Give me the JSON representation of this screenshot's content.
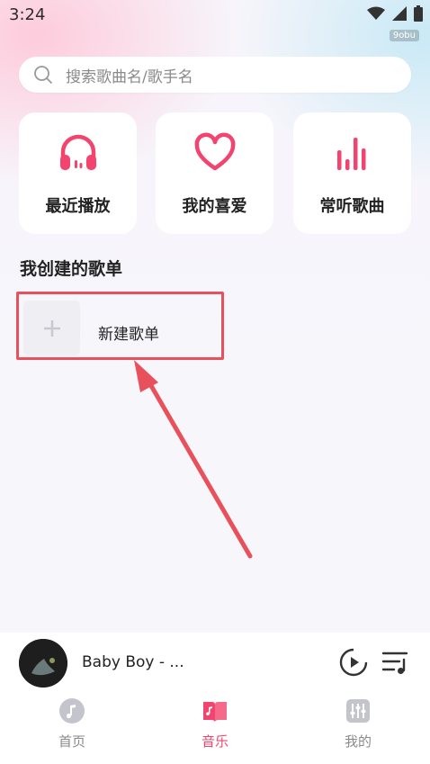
{
  "status": {
    "time": "3:24",
    "watermark": "9obu"
  },
  "search": {
    "placeholder": "搜索歌曲名/歌手名"
  },
  "quick_cards": [
    {
      "label": "最近播放",
      "icon": "headphones-icon"
    },
    {
      "label": "我的喜爱",
      "icon": "heart-icon"
    },
    {
      "label": "常听歌曲",
      "icon": "bars-icon"
    }
  ],
  "section": {
    "title": "我创建的歌单"
  },
  "new_playlist": {
    "label": "新建歌单"
  },
  "player": {
    "song": "Baby Boy - ..."
  },
  "nav": [
    {
      "label": "首页",
      "icon": "music-note-icon"
    },
    {
      "label": "音乐",
      "icon": "book-icon"
    },
    {
      "label": "我的",
      "icon": "sliders-icon"
    }
  ],
  "colors": {
    "accent": "#f2446e",
    "highlight_border": "#e8505b"
  }
}
